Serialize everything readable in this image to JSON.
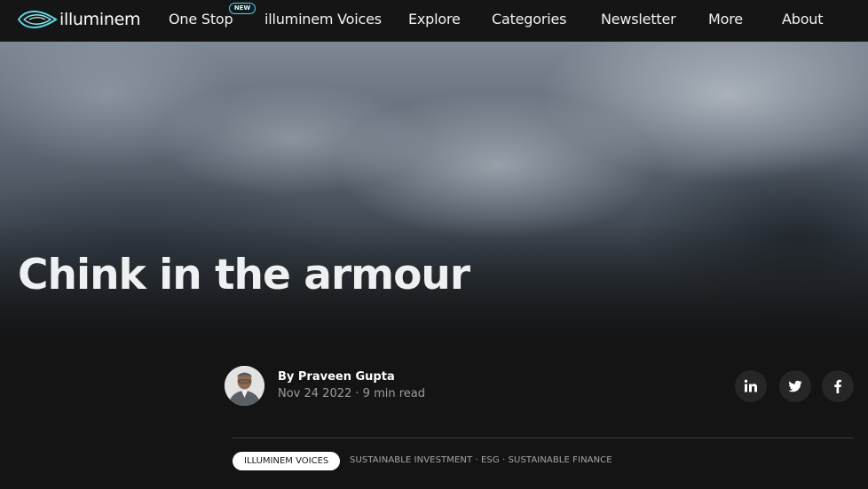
{
  "brand": {
    "name": "illuminem"
  },
  "nav": {
    "items": [
      {
        "label": "One Stop"
      },
      {
        "label": "illuminem Voices"
      },
      {
        "label": "Explore"
      },
      {
        "label": "Categories"
      },
      {
        "label": "Newsletter"
      },
      {
        "label": "More"
      },
      {
        "label": "About"
      }
    ],
    "badge": "NEW"
  },
  "article": {
    "title": "Chink in the armour",
    "author": "By Praveen Gupta",
    "meta": "Nov 24 2022 · 9 min read"
  },
  "social": [
    "linkedin-icon",
    "twitter-icon",
    "facebook-icon"
  ],
  "tags": {
    "primary": "ILLUMINEM VOICES",
    "others": [
      "SUSTAINABLE INVESTMENT",
      "ESG",
      "SUSTAINABLE FINANCE"
    ],
    "separator": " · "
  },
  "colors": {
    "background": "#141414",
    "badge_border": "#4bd4e8"
  }
}
